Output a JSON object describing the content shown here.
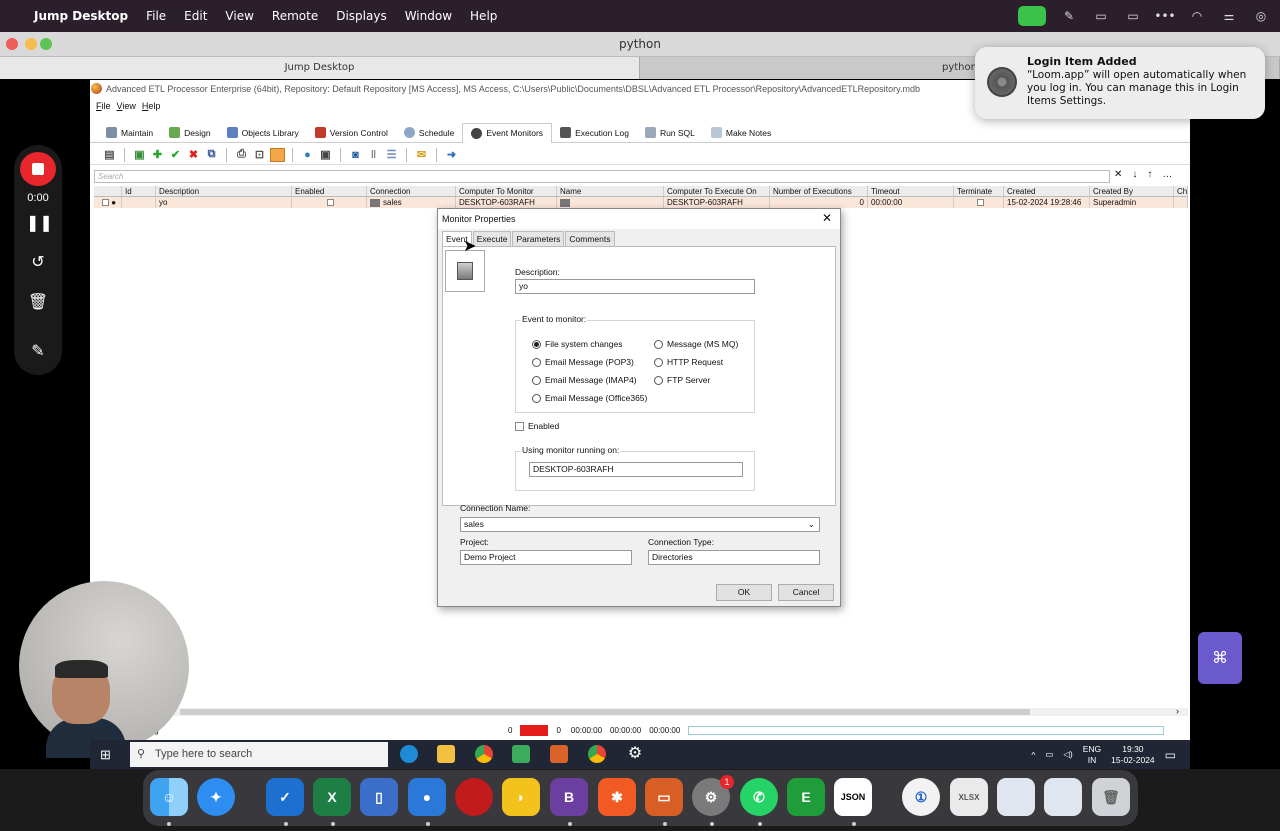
{
  "menubar": {
    "app": "Jump Desktop",
    "items": [
      "File",
      "Edit",
      "View",
      "Remote",
      "Displays",
      "Window",
      "Help"
    ]
  },
  "window": {
    "title": "python",
    "tabs": [
      "Jump Desktop",
      "python"
    ]
  },
  "notification": {
    "title": "Login Item Added",
    "body": "“Loom.app” will open automatically when you log in. You can manage this in Login Items Settings."
  },
  "recorder": {
    "time": "0:00"
  },
  "app": {
    "title": "Advanced ETL Processor Enterprise (64bit), Repository: Default Repository  [MS Access], MS Access, C:\\Users\\Public\\Documents\\DBSL\\Advanced ETL Processor\\Repository\\AdvancedETLRepository.mdb",
    "menu": [
      "File",
      "View",
      "Help"
    ],
    "ribbon": [
      "Maintain",
      "Design",
      "Objects Library",
      "Version Control",
      "Schedule",
      "Event Monitors",
      "Execution Log",
      "Run SQL",
      "Make Notes"
    ],
    "search_placeholder": "Search",
    "grid": {
      "columns": [
        "Id",
        "Description",
        "Enabled",
        "Connection",
        "Computer To Monitor",
        "Name",
        "Computer To Execute On",
        "Number of Executions",
        "Timeout",
        "Terminate",
        "Created",
        "Created By",
        "Ch"
      ],
      "rows": [
        {
          "description": "yo",
          "connection": "sales",
          "computer_to_monitor": "DESKTOP-603RAFH",
          "computer_to_execute": "DESKTOP-603RAFH",
          "executions": "0",
          "timeout": "00:00:00",
          "created": "15-02-2024 19:28:46",
          "created_by": "Superadmin"
        }
      ]
    },
    "status": {
      "left": "ing",
      "n1": "0",
      "n2": "0",
      "t1": "00:00:00",
      "t2": "00:00:00",
      "t3": "00:00:00"
    }
  },
  "dialog": {
    "title": "Monitor Properties",
    "tabs": [
      "Event",
      "Execute",
      "Parameters",
      "Comments"
    ],
    "description_label": "Description:",
    "description_value": "yo",
    "event_group_label": "Event to monitor:",
    "events": [
      {
        "label": "File system changes",
        "selected": true
      },
      {
        "label": "Email Message (POP3)",
        "selected": false
      },
      {
        "label": "Email Message (IMAP4)",
        "selected": false
      },
      {
        "label": "Email Message (Office365)",
        "selected": false
      },
      {
        "label": "Message (MS MQ)",
        "selected": false
      },
      {
        "label": "HTTP Request",
        "selected": false
      },
      {
        "label": "FTP Server",
        "selected": false
      }
    ],
    "enabled_label": "Enabled",
    "enabled": false,
    "monitor_group_label": "Using monitor running on:",
    "monitor_value": "DESKTOP-603RAFH",
    "connection_label": "Connection Name:",
    "connection_value": "sales",
    "project_label": "Project:",
    "project_value": "Demo Project",
    "conn_type_label": "Connection Type:",
    "conn_type_value": "Directories",
    "ok": "OK",
    "cancel": "Cancel"
  },
  "wintaskbar": {
    "search": "Type here to search",
    "lang1": "ENG",
    "lang2": "IN",
    "time": "19:30",
    "date": "15-02-2024"
  },
  "dock": {
    "json_label": "JSON",
    "badge": "1"
  },
  "colors": {
    "menubar": "#2b1f2b",
    "record": "#e8262b",
    "selected_row": "#fbe6da"
  }
}
